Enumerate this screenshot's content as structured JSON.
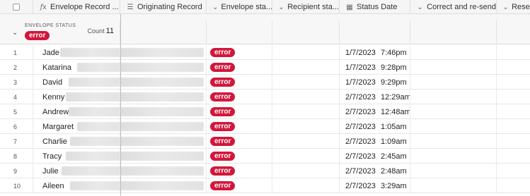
{
  "columns": {
    "name": {
      "icon": "formula-icon",
      "label": "Envelope Record ..."
    },
    "originating": {
      "icon": "lines-icon",
      "label": "Originating Record"
    },
    "envelope_status": {
      "icon": "chevron-circle-icon",
      "label": "Envelope sta..."
    },
    "recipient_status": {
      "icon": "chevron-circle-icon",
      "label": "Recipient sta..."
    },
    "status_date": {
      "icon": "calendar-icon",
      "label": "Status Date"
    },
    "correct_resend": {
      "icon": "chevron-circle-icon",
      "label": "Correct and re-send"
    },
    "resend": {
      "icon": "chevron-circle-icon",
      "label": "Resend"
    }
  },
  "group": {
    "label": "ENVELOPE STATUS",
    "value": "error",
    "count_label": "Count",
    "count": "11"
  },
  "colors": {
    "error_badge": "#d3163a"
  },
  "rows": [
    {
      "num": "1",
      "name": "Jade",
      "status": "error",
      "date": "1/7/2023",
      "time": "7:46pm"
    },
    {
      "num": "2",
      "name": "Katarina",
      "status": "error",
      "date": "1/7/2023",
      "time": "9:28pm"
    },
    {
      "num": "3",
      "name": "David",
      "status": "error",
      "date": "1/7/2023",
      "time": "9:29pm"
    },
    {
      "num": "4",
      "name": "Kenny",
      "status": "error",
      "date": "2/7/2023",
      "time": "12:29am"
    },
    {
      "num": "5",
      "name": "Andrew",
      "status": "error",
      "date": "2/7/2023",
      "time": "12:48am"
    },
    {
      "num": "6",
      "name": "Margaret",
      "status": "error",
      "date": "2/7/2023",
      "time": "1:05am"
    },
    {
      "num": "7",
      "name": "Charlie",
      "status": "error",
      "date": "2/7/2023",
      "time": "1:09am"
    },
    {
      "num": "8",
      "name": "Tracy",
      "status": "error",
      "date": "2/7/2023",
      "time": "2:45am"
    },
    {
      "num": "9",
      "name": "Julie",
      "status": "error",
      "date": "2/7/2023",
      "time": "2:48am"
    },
    {
      "num": "10",
      "name": "Aileen",
      "status": "error",
      "date": "2/7/2023",
      "time": "3:29am"
    }
  ]
}
